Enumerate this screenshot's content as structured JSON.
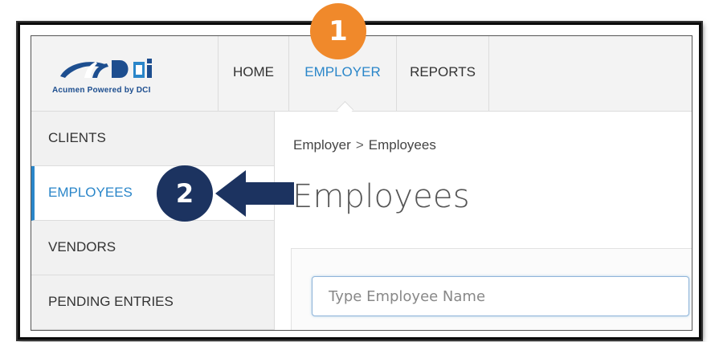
{
  "brand": {
    "logo_tagline": "Acumen Powered by DCI",
    "logo_colors": {
      "navy": "#1d4e8f",
      "blue": "#2a86c9"
    }
  },
  "topnav": {
    "items": [
      {
        "label": "HOME",
        "active": false
      },
      {
        "label": "EMPLOYER",
        "active": true
      },
      {
        "label": "REPORTS",
        "active": false
      }
    ]
  },
  "sidebar": {
    "items": [
      {
        "label": "CLIENTS",
        "active": false
      },
      {
        "label": "EMPLOYEES",
        "active": true
      },
      {
        "label": "VENDORS",
        "active": false
      },
      {
        "label": "PENDING ENTRIES",
        "active": false
      }
    ]
  },
  "breadcrumb": {
    "items": [
      "Employer",
      "Employees"
    ],
    "separator": ">"
  },
  "page": {
    "title": "Employees"
  },
  "search": {
    "placeholder": "Type Employee Name",
    "value": ""
  },
  "annotations": {
    "step1": {
      "number": "1",
      "color": "#f0892b"
    },
    "step2": {
      "number": "2",
      "color": "#1c3360"
    },
    "arrow_color": "#1c3360"
  },
  "colors": {
    "accent": "#2a86c9"
  }
}
